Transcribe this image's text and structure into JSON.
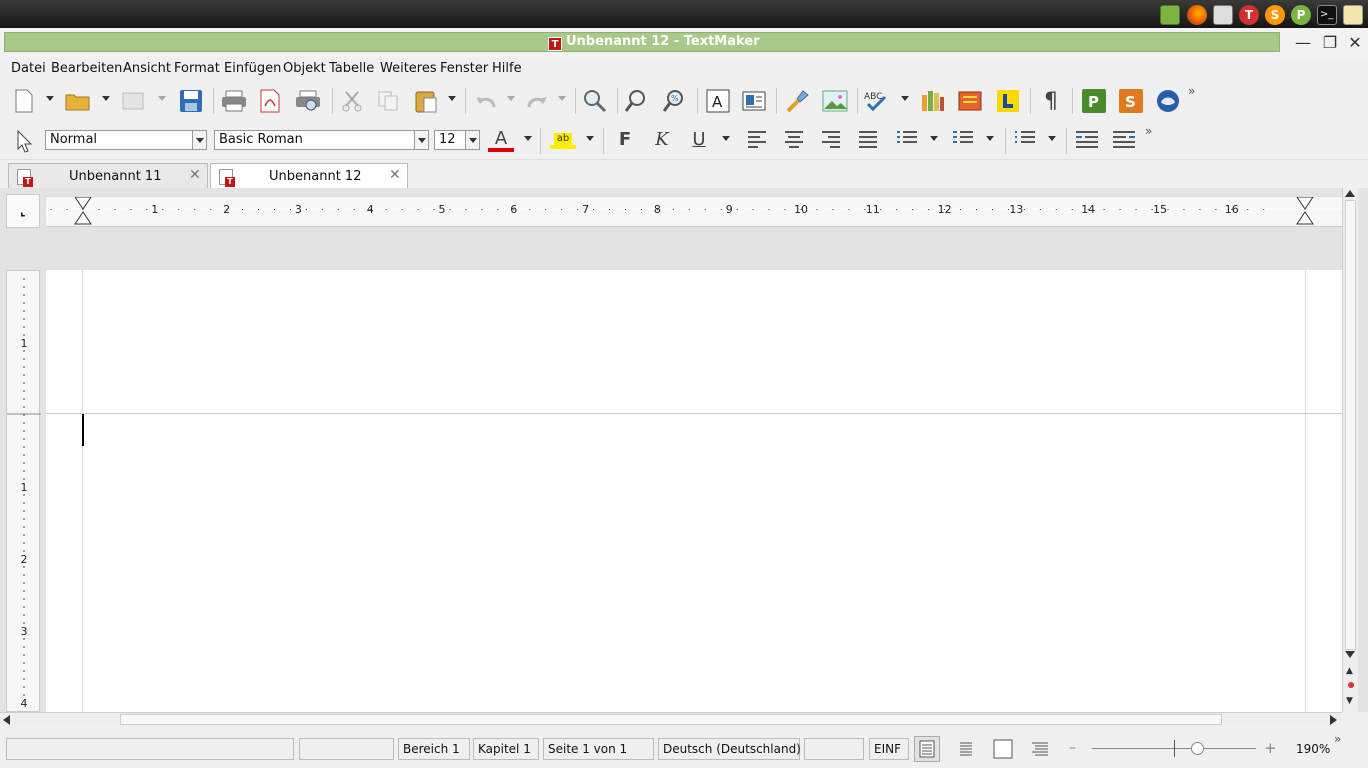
{
  "taskbar": {
    "tray": [
      "folder-icon",
      "firefox-icon",
      "screenshot-icon",
      "textmaker-tray-icon",
      "softmaker-s-icon",
      "presentations-p-icon",
      "terminal-icon",
      "notes-icon"
    ]
  },
  "window": {
    "title": "Unbenannt 12 - TextMaker"
  },
  "menu": [
    "Datei",
    "Bearbeiten",
    "Ansicht",
    "Format",
    "Einfügen",
    "Objekt",
    "Tabelle",
    "Weiteres",
    "Fenster",
    "Hilfe"
  ],
  "format_bar": {
    "style": "Normal",
    "font": "Basic Roman",
    "size": "12",
    "bold": "F",
    "italic": "K",
    "underline": "U"
  },
  "tabs": [
    {
      "label": "Unbenannt 11"
    },
    {
      "label": "Unbenannt 12"
    }
  ],
  "ruler": {
    "h_marks": [
      "1",
      "2",
      "3",
      "4",
      "5",
      "6",
      "7",
      "8",
      "9",
      "10",
      "11",
      "12",
      "13",
      "14",
      "15",
      "16"
    ],
    "v_marks": [
      "1",
      "1",
      "2",
      "3",
      "4"
    ]
  },
  "status": {
    "fields": [
      "",
      "",
      "Bereich 1",
      "Kapitel 1",
      "Seite 1 von 1",
      "Deutsch (Deutschland)",
      "",
      "EINF"
    ],
    "zoom": "190%"
  },
  "colors": {
    "title_bar": "#a9c98a",
    "font_color": "#dd0000",
    "highlight": "#ffee00",
    "accent_red": "#c01818"
  }
}
